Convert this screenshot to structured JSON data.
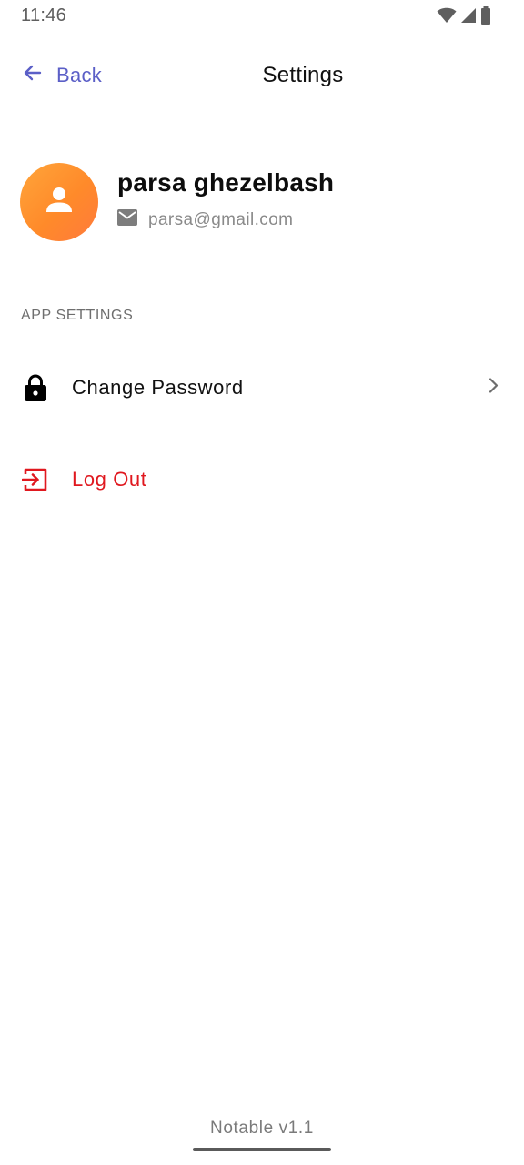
{
  "status_bar": {
    "time": "11:46",
    "icons": [
      "wifi-icon",
      "cellular-signal-icon",
      "battery-icon"
    ]
  },
  "header": {
    "back_label": "Back",
    "title": "Settings",
    "accent_color": "#5b5fc7"
  },
  "profile": {
    "name": "parsa ghezelbash",
    "email": "parsa@gmail.com",
    "avatar_icon": "person-icon",
    "email_icon": "mail-icon",
    "avatar_color": "#ff8f2f"
  },
  "app_settings": {
    "section_title": "APP SETTINGS",
    "items": [
      {
        "label": "Change Password",
        "icon": "lock-icon",
        "trailing_icon": "chevron-right-icon"
      },
      {
        "label": "Log Out",
        "icon": "logout-icon",
        "color": "#e0181f"
      }
    ]
  },
  "footer": {
    "version": "Notable v1.1"
  }
}
